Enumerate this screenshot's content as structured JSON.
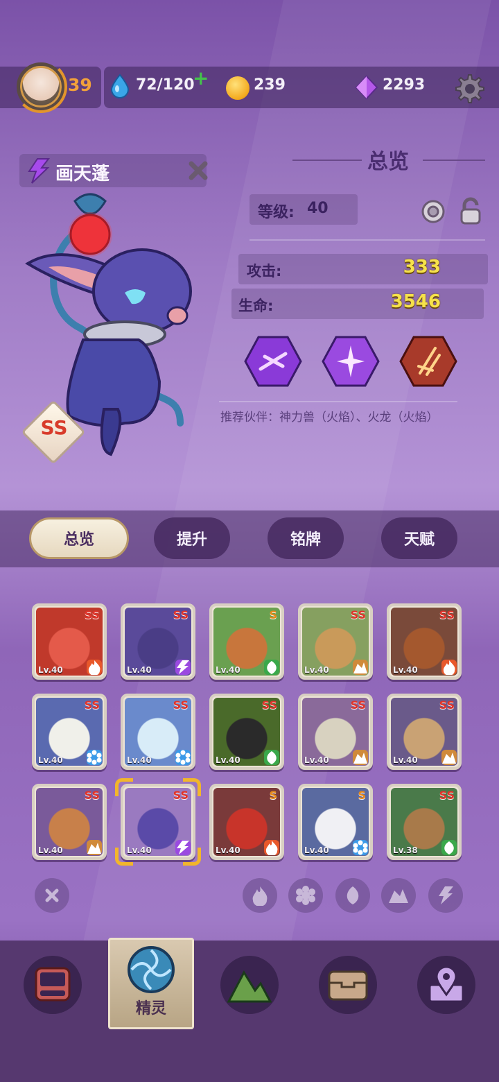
{
  "topbar": {
    "player_level": "39",
    "energy": "72/120",
    "coins": "239",
    "gems": "2293"
  },
  "character": {
    "name": "画天蓬",
    "rank": "SS"
  },
  "overview": {
    "title": "总览",
    "level_label": "等级:",
    "level_value": "40",
    "attack_label": "攻击:",
    "attack_value": "333",
    "hp_label": "生命:",
    "hp_value": "3546",
    "recommend_text": "推荐伙伴：神力兽（火焰）、火龙（火焰）"
  },
  "tabs": [
    "总览",
    "提升",
    "铭牌",
    "天赋"
  ],
  "spirits": [
    {
      "lv": "Lv.40",
      "rank": "SS",
      "element": "fire",
      "bg": "#c0392b",
      "face": "#e45a4a"
    },
    {
      "lv": "Lv.40",
      "rank": "SS",
      "element": "thunder",
      "bg": "#5a4a9a",
      "face": "#4a3d86"
    },
    {
      "lv": "Lv.40",
      "rank": "S",
      "element": "grass",
      "bg": "#6aa050",
      "face": "#c8763c"
    },
    {
      "lv": "Lv.40",
      "rank": "SS",
      "element": "earth",
      "bg": "#86a060",
      "face": "#c99a5a"
    },
    {
      "lv": "Lv.40",
      "rank": "SS",
      "element": "fire",
      "bg": "#7a4a3a",
      "face": "#a4582e"
    },
    {
      "lv": "Lv.40",
      "rank": "SS",
      "element": "ice",
      "bg": "#5a6ab0",
      "face": "#f0f0ea"
    },
    {
      "lv": "Lv.40",
      "rank": "SS",
      "element": "ice",
      "bg": "#6a8acc",
      "face": "#d8ecf8"
    },
    {
      "lv": "Lv.40",
      "rank": "SS",
      "element": "grass",
      "bg": "#4a6a2a",
      "face": "#2a2a2a"
    },
    {
      "lv": "Lv.40",
      "rank": "SS",
      "element": "earth",
      "bg": "#8a6a9a",
      "face": "#d8d2c0"
    },
    {
      "lv": "Lv.40",
      "rank": "SS",
      "element": "earth",
      "bg": "#6a5a8a",
      "face": "#c9a274"
    },
    {
      "lv": "Lv.40",
      "rank": "SS",
      "element": "earth",
      "bg": "#7a5a9a",
      "face": "#c8804a"
    },
    {
      "lv": "Lv.40",
      "rank": "SS",
      "element": "thunder",
      "bg": "#9a7ac0",
      "face": "#5a4aa8",
      "selected": true
    },
    {
      "lv": "Lv.40",
      "rank": "S",
      "element": "fire",
      "bg": "#7a3a3a",
      "face": "#c8342a"
    },
    {
      "lv": "Lv.40",
      "rank": "S",
      "element": "ice",
      "bg": "#5a6aa0",
      "face": "#f0f0f4"
    },
    {
      "lv": "Lv.38",
      "rank": "SS",
      "element": "grass",
      "bg": "#4a7a4a",
      "face": "#a87a4a"
    }
  ],
  "nav": {
    "active_label": "精灵"
  },
  "colors": {
    "fire": "#e8582a",
    "thunder": "#9a4ae0",
    "grass": "#3aa84a",
    "earth": "#d08a3a",
    "ice": "#3a9ae8"
  }
}
